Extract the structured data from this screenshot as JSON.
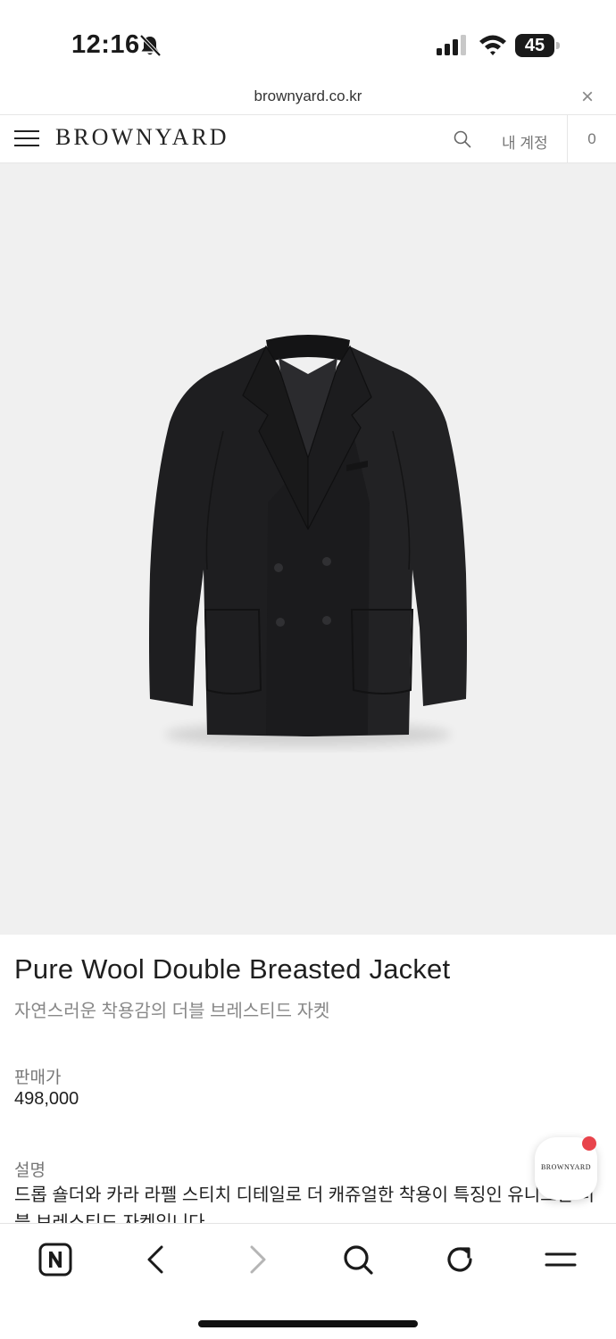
{
  "status_bar": {
    "time": "12:16",
    "battery": "45",
    "icons": [
      "bell-slash-icon",
      "cellular-signal-icon",
      "wifi-icon",
      "battery-icon"
    ]
  },
  "browser": {
    "url": "brownyard.co.kr",
    "close_label": "×"
  },
  "header": {
    "logo": "BROWNYARD",
    "account_label": "내 계정",
    "cart_count": "0",
    "icons": [
      "menu-icon",
      "search-icon"
    ]
  },
  "product": {
    "image_icon": "double-breasted-jacket-image",
    "name": "Pure Wool Double Breasted Jacket",
    "subtitle": "자연스러운 착용감의 더블 브레스티드 자켓",
    "price_label": "판매가",
    "price": "498,000",
    "description_label": "설명",
    "description": "드롭 숄더와 카라 라펠 스티치 디테일로 더 캐쥬얼한 착용이 특징인 유니크한 더블 브레스티드 자켓입니다"
  },
  "chat_badge": {
    "label": "BROWNYARD",
    "dot_color": "#e8434b"
  },
  "toolbar": {
    "icons": [
      "naver-home-icon",
      "back-arrow-icon",
      "forward-arrow-icon",
      "search-icon",
      "refresh-icon",
      "menu-icon"
    ]
  },
  "colors": {
    "image_background": "#f0f0f0",
    "jacket": "#1e1e20"
  }
}
